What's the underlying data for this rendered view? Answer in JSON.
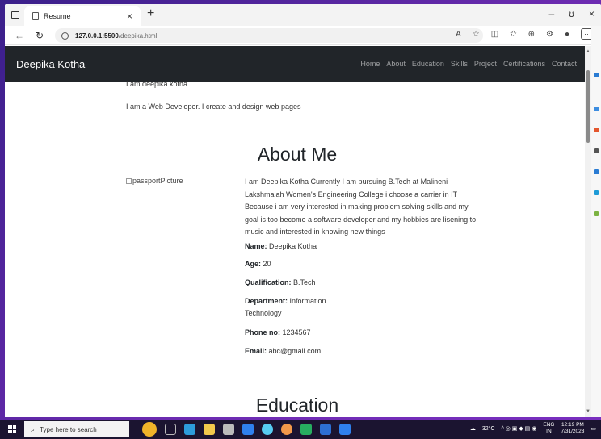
{
  "browser": {
    "tab_title": "Resume",
    "url_host": "127.0.0.1:5500",
    "url_path": "/deepika.html"
  },
  "site": {
    "brand": "Deepika Kotha",
    "nav": [
      "Home",
      "About",
      "Education",
      "Skills",
      "Project",
      "Certifications",
      "Contact"
    ],
    "intro_line1": "I am deepika kotha",
    "intro_line2": "I am a Web Developer. I create and design web pages",
    "about_heading": "About Me",
    "photo_alt": "passportPicture",
    "about_text": "I am Deepika Kotha Currently I am pursuing B.Tech at Malineni Lakshmaiah Women's Engineering College i choose a carrier in IT Because i am very interested in making problem solving skills and my goal is too become a software developer and my hobbies are lisening to music and interested in knowing new things",
    "fields": [
      {
        "label": "Name:",
        "value": " Deepika Kotha"
      },
      {
        "label": "Age:",
        "value": " 20"
      },
      {
        "label": "Qualification:",
        "value": " B.Tech"
      },
      {
        "label": "Department:",
        "value": " Information Technology"
      },
      {
        "label": "Phone no:",
        "value": " 1234567"
      },
      {
        "label": "Email:",
        "value": " abc@gmail.com"
      }
    ],
    "education_heading": "Education"
  },
  "taskbar": {
    "search_placeholder": "Type here to search",
    "weather": "32°C",
    "lang": "ENG",
    "region": "IN",
    "time": "12:19 PM",
    "date": "7/31/2023"
  },
  "colors": {
    "navbar_bg": "#212529",
    "desktop_bg": "#5a27a0"
  }
}
